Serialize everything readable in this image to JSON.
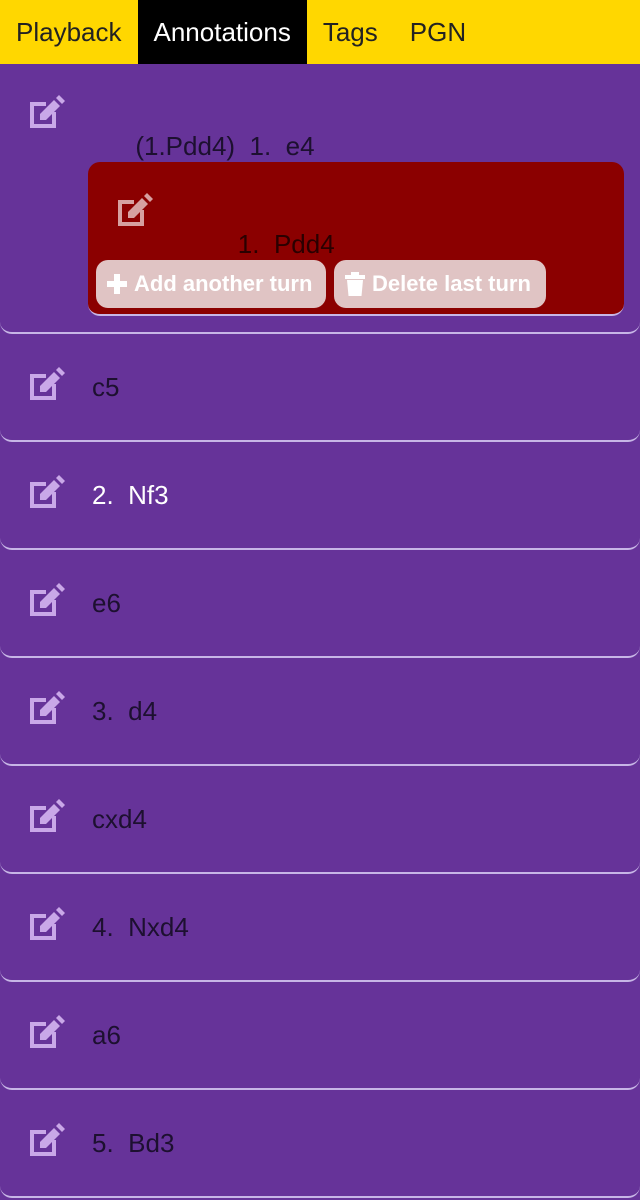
{
  "tabs": [
    {
      "label": "Playback",
      "active": false
    },
    {
      "label": "Annotations",
      "active": true
    },
    {
      "label": "Tags",
      "active": false
    },
    {
      "label": "PGN",
      "active": false
    }
  ],
  "colors": {
    "tab_bar": "#ffd700",
    "active_tab": "#000000",
    "row_bg": "#663399",
    "variation_bg": "#8b0000",
    "button_bg": "#e0c4c4",
    "icon": "#c9a8e8"
  },
  "moves": [
    {
      "prefix": "(1.Pdd4)",
      "number": "1.",
      "san": "e4",
      "light": false
    },
    {
      "prefix": "",
      "number": "",
      "san": "c5",
      "light": false
    },
    {
      "prefix": "",
      "number": "2.",
      "san": "Nf3",
      "light": true
    },
    {
      "prefix": "",
      "number": "",
      "san": "e6",
      "light": false
    },
    {
      "prefix": "",
      "number": "3.",
      "san": "d4",
      "light": false
    },
    {
      "prefix": "",
      "number": "",
      "san": "cxd4",
      "light": false
    },
    {
      "prefix": "",
      "number": "4.",
      "san": "Nxd4",
      "light": false
    },
    {
      "prefix": "",
      "number": "",
      "san": "a6",
      "light": false
    },
    {
      "prefix": "",
      "number": "5.",
      "san": "Bd3",
      "light": false
    }
  ],
  "variation": {
    "number": "1.",
    "san": "Pdd4",
    "add_label": "Add another turn",
    "delete_label": "Delete last turn"
  },
  "icons": {
    "edit": "edit-icon",
    "plus": "plus-icon",
    "trash": "trash-icon"
  }
}
